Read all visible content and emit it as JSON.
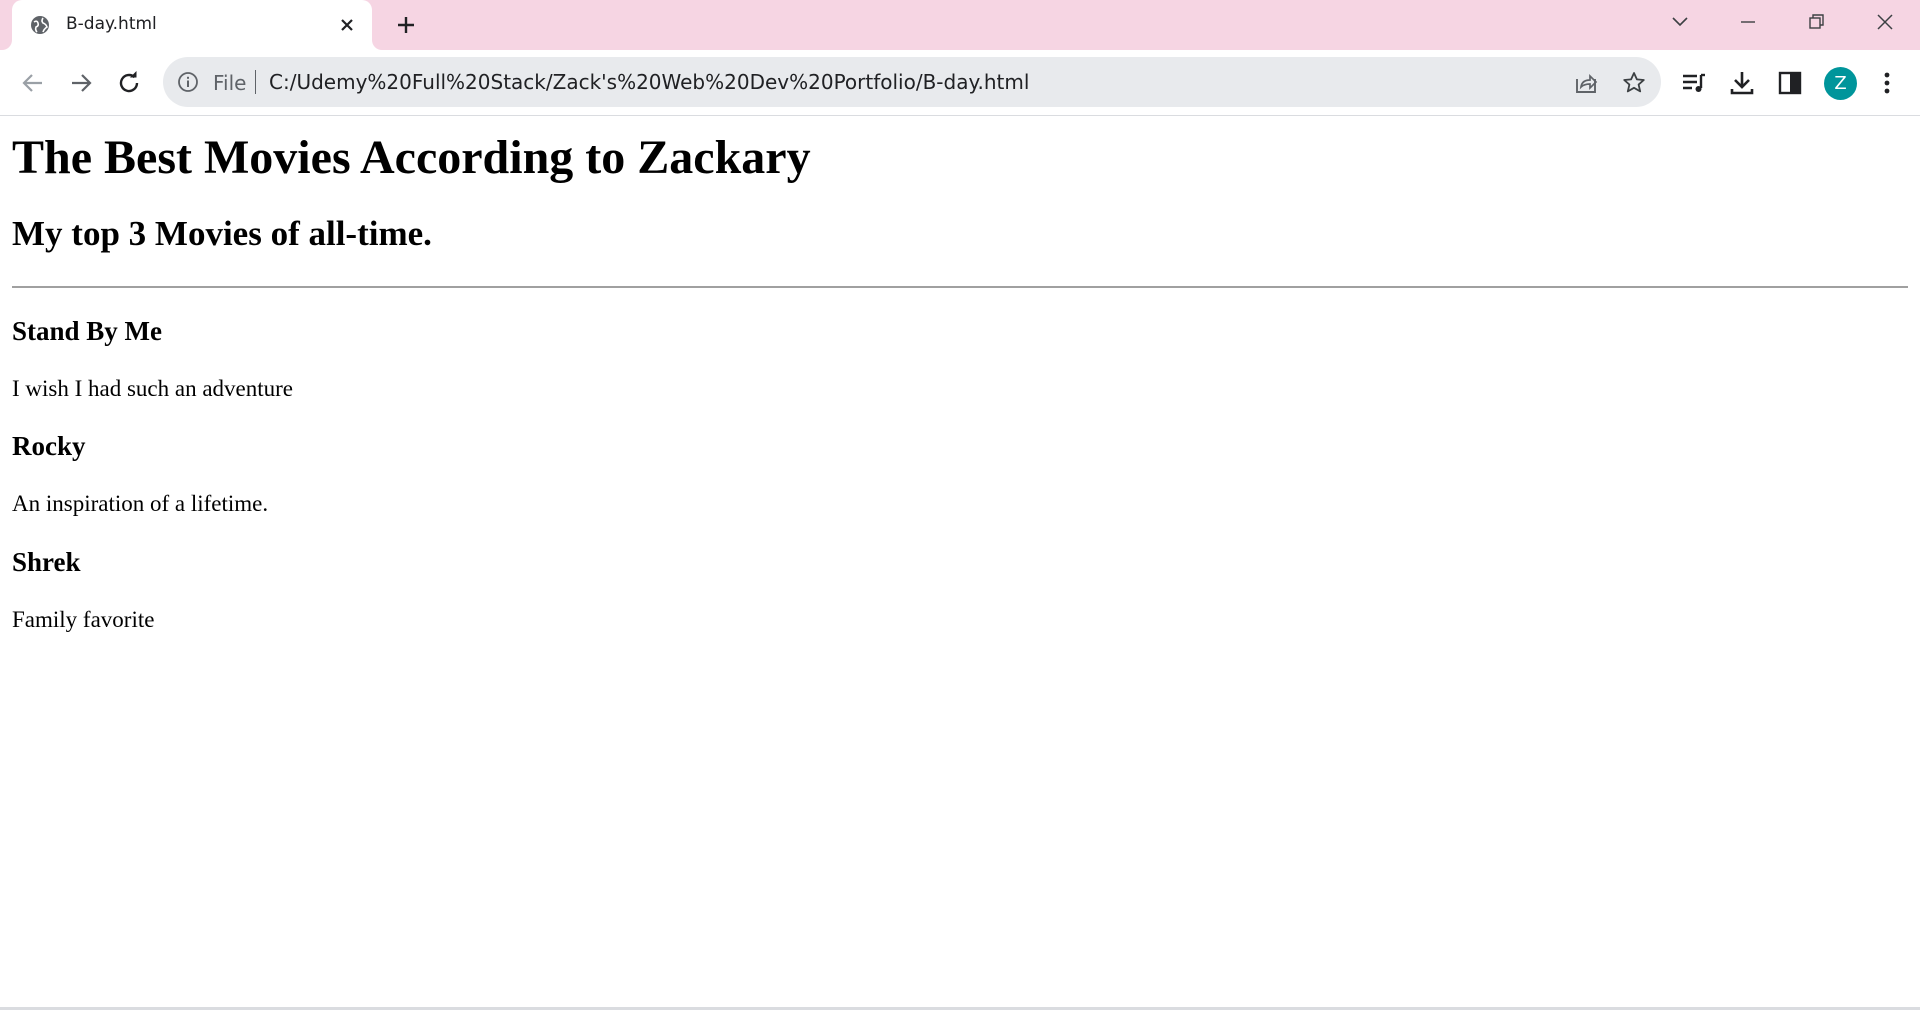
{
  "browser": {
    "tab": {
      "title": "B-day.html"
    },
    "omnibox": {
      "scheme_label": "File",
      "url": "C:/Udemy%20Full%20Stack/Zack's%20Web%20Dev%20Portfolio/B-day.html"
    },
    "profile": {
      "initial": "Z",
      "color": "#00959b"
    },
    "colors": {
      "tabstrip": "#f6d5e3",
      "omnibox": "#e8eaed"
    },
    "icons": [
      "globe-icon",
      "close-icon",
      "plus-icon",
      "chevron-down-icon",
      "minimize-icon",
      "restore-icon",
      "close-window-icon",
      "back-arrow-icon",
      "forward-arrow-icon",
      "reload-icon",
      "info-icon",
      "share-icon",
      "star-icon",
      "media-queue-icon",
      "download-icon",
      "side-panel-icon",
      "kebab-menu-icon"
    ]
  },
  "page": {
    "heading": "The Best Movies According to Zackary",
    "subheading": "My top 3 Movies of all-time.",
    "movies": [
      {
        "title": "Stand By Me",
        "description": "I wish I had such an adventure"
      },
      {
        "title": "Rocky",
        "description": "An inspiration of a lifetime."
      },
      {
        "title": "Shrek",
        "description": "Family favorite"
      }
    ]
  }
}
